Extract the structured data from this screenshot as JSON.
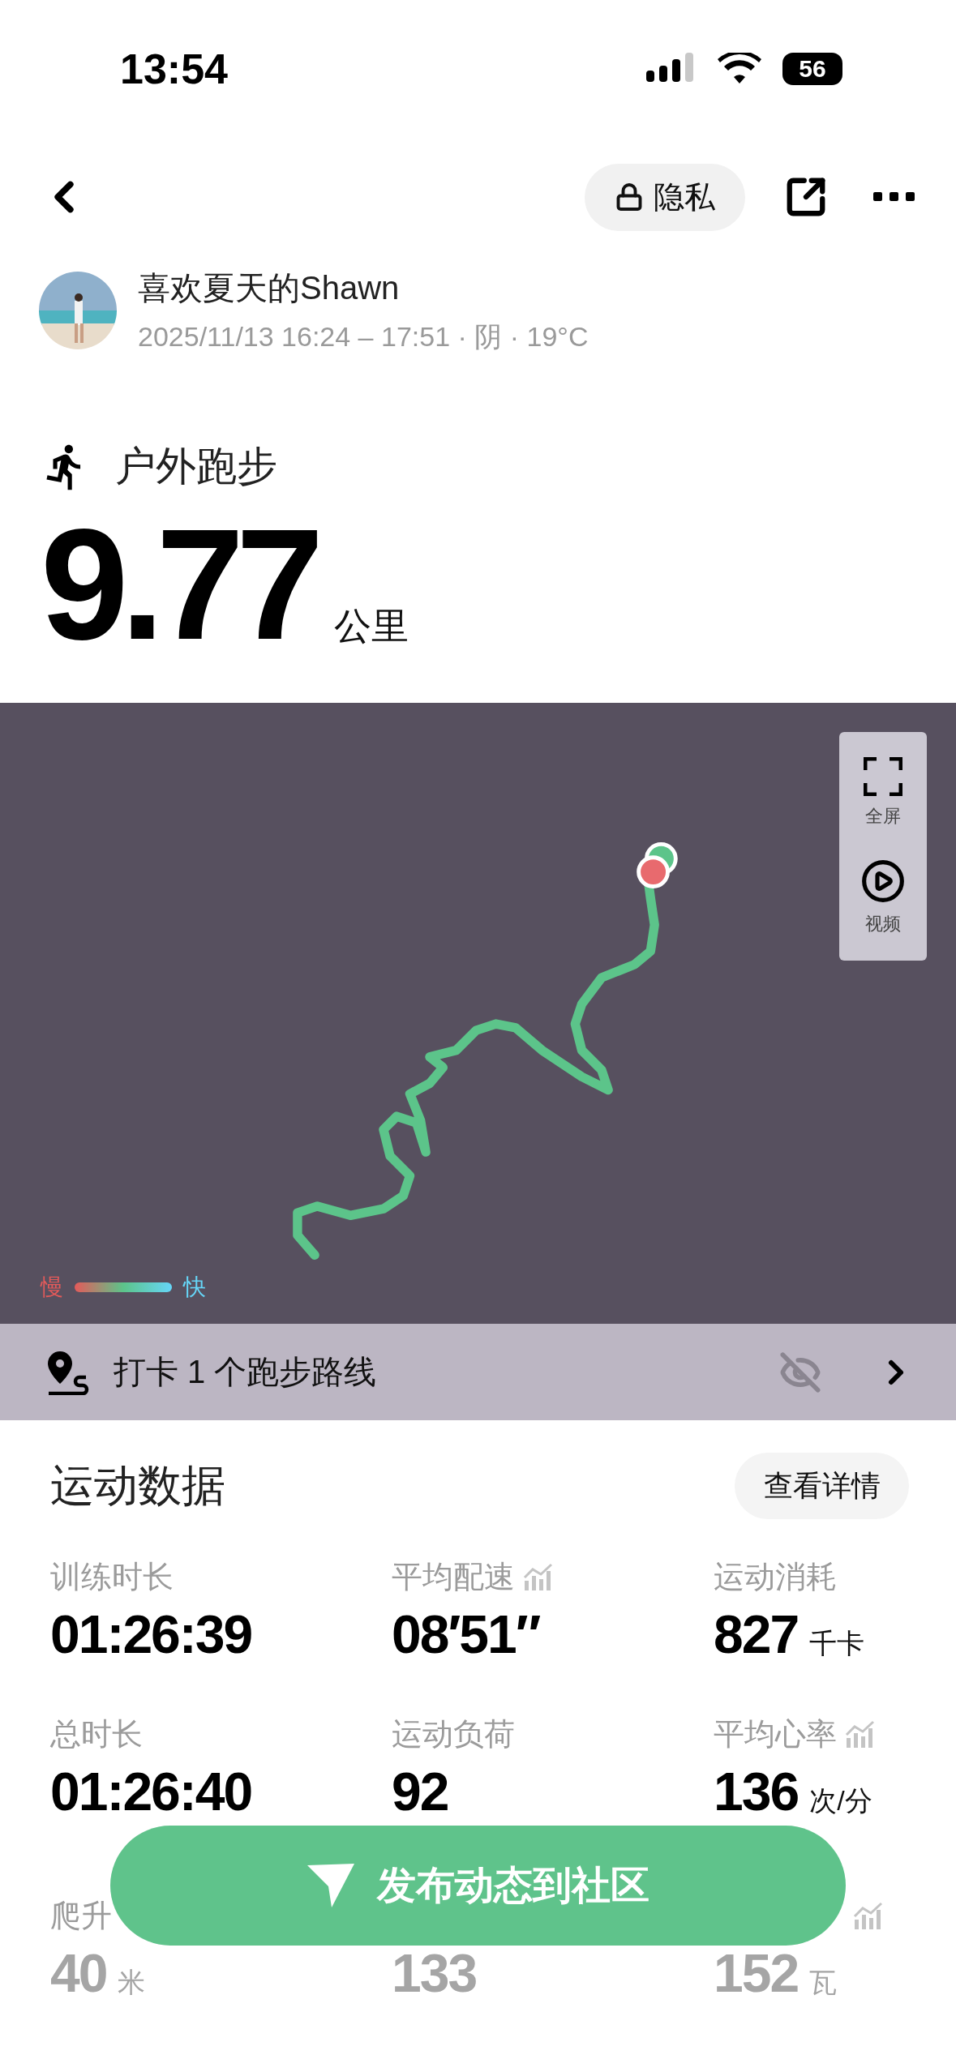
{
  "status_bar": {
    "time": "13:54",
    "battery": "56"
  },
  "nav": {
    "privacy_label": "隐私"
  },
  "user": {
    "name": "喜欢夏天的Shawn",
    "meta": "2025/11/13 16:24 – 17:51 · 阴 · 19°C"
  },
  "activity": {
    "type": "户外跑步",
    "distance": "9.77",
    "unit": "公里"
  },
  "map": {
    "controls": [
      {
        "kind": "fullscreen",
        "label": "全屏"
      },
      {
        "kind": "video",
        "label": "视频"
      }
    ],
    "legend": {
      "slow": "慢",
      "fast": "快"
    }
  },
  "checkin": {
    "text": "打卡 1 个跑步路线"
  },
  "stats": {
    "title": "运动数据",
    "details_button": "查看详情",
    "items": [
      {
        "label": "训练时长",
        "value": "01:26:39",
        "trend": false,
        "dimmed": false
      },
      {
        "label": "平均配速",
        "value": "08′51″",
        "trend": true,
        "dimmed": false
      },
      {
        "label": "运动消耗",
        "value": "827",
        "unit": "千卡",
        "trend": false,
        "dimmed": false
      },
      {
        "label": "总时长",
        "value": "01:26:40",
        "trend": false,
        "dimmed": false
      },
      {
        "label": "运动负荷",
        "value": "92",
        "trend": false,
        "dimmed": false
      },
      {
        "label": "平均心率",
        "value": "136",
        "unit": "次/分",
        "trend": true,
        "dimmed": false
      },
      {
        "label": "爬升",
        "value": "40",
        "unit": "米",
        "trend": false,
        "dimmed": true
      },
      {
        "value": "133",
        "trend": false,
        "dimmed": true
      },
      {
        "value": "152",
        "unit": "瓦",
        "trend": true,
        "dimmed": true
      }
    ]
  },
  "publish_button": "发布动态到社区"
}
